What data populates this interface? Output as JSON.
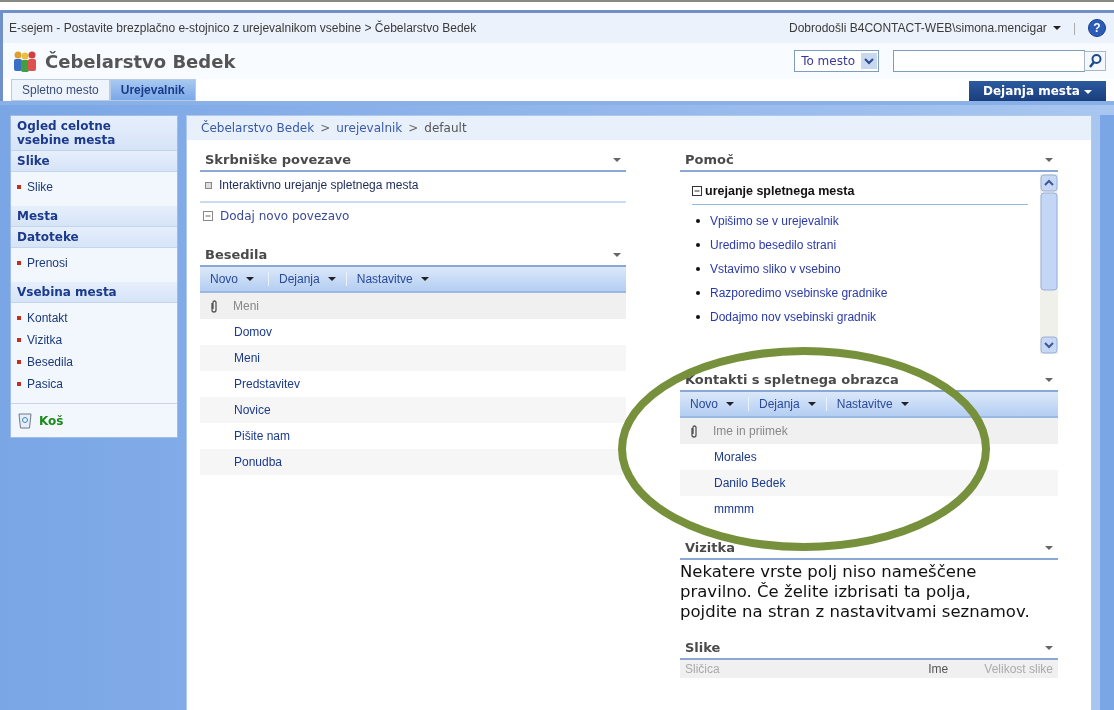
{
  "top_bar": {
    "breadcrumb": "E-sejem - Postavite brezplačno e-stojnico z urejevalnikom vsebine > Čebelarstvo Bedek",
    "welcome": "Dobrodošli B4CONTACT-WEB\\simona.mencigar",
    "separator": "|",
    "help_icon": "?"
  },
  "site_title": "Čebelarstvo Bedek",
  "search": {
    "scope": "To mesto"
  },
  "tabs": [
    {
      "label": "Spletno mesto",
      "selected": false
    },
    {
      "label": "Urejevalnik",
      "selected": true
    }
  ],
  "site_actions": "Dejanja mesta",
  "sidebar": {
    "view_all": "Ogled celotne vsebine mesta",
    "sections": [
      {
        "heading": "Slike",
        "items": [
          "Slike"
        ]
      },
      {
        "heading": "Mesta"
      },
      {
        "heading": "Datoteke",
        "items": [
          "Prenosi"
        ]
      },
      {
        "heading": "Vsebina mesta",
        "items": [
          "Kontakt",
          "Vizitka",
          "Besedila",
          "Pasica"
        ]
      }
    ],
    "recycle_bin": "Koš"
  },
  "breadcrumb": {
    "separator": ">",
    "parts": [
      {
        "label": "Čebelarstvo Bedek",
        "link": true
      },
      {
        "label": "urejevalnik",
        "link": true
      },
      {
        "label": "default",
        "link": false
      }
    ]
  },
  "left_column": [
    {
      "kind": "links",
      "title": "Skrbniške povezave",
      "links": [
        "Interaktivno urejanje spletnega mesta"
      ],
      "add_link": "Dodaj novo povezavo"
    },
    {
      "kind": "list",
      "title": "Besedila",
      "toolbar": [
        "Novo",
        "Dejanja",
        "Nastavitve"
      ],
      "column": "Meni",
      "rows": [
        "Domov",
        "Meni",
        "Predstavitev",
        "Novice",
        "Pišite nam",
        "Ponudba"
      ]
    }
  ],
  "right_column": [
    {
      "kind": "help",
      "title": "Pomoč",
      "section": "urejanje spletnega mesta",
      "items": [
        "Vpišimo se v urejevalnik",
        "Uredimo besedilo strani",
        "Vstavimo sliko v vsebino",
        "Razporedimo vsebinske gradnike",
        "Dodajmo nov vsebinski gradnik"
      ]
    },
    {
      "kind": "list",
      "title": "Kontakti s spletnega obrazca",
      "toolbar": [
        "Novo",
        "Dejanja",
        "Nastavitve"
      ],
      "column": "Ime in priimek",
      "rows": [
        "Morales",
        "Danilo Bedek",
        "mmmm"
      ],
      "highlighted": true
    },
    {
      "kind": "message",
      "title": "Vizitka",
      "message": "Nekatere vrste polj niso nameščene pravilno. Če želite izbrisati ta polja, pojdite na stran z nastavitvami seznamov."
    },
    {
      "kind": "columns",
      "title": "Slike",
      "columns": [
        "Sličica",
        "Ime",
        "Velikost slike"
      ]
    }
  ]
}
